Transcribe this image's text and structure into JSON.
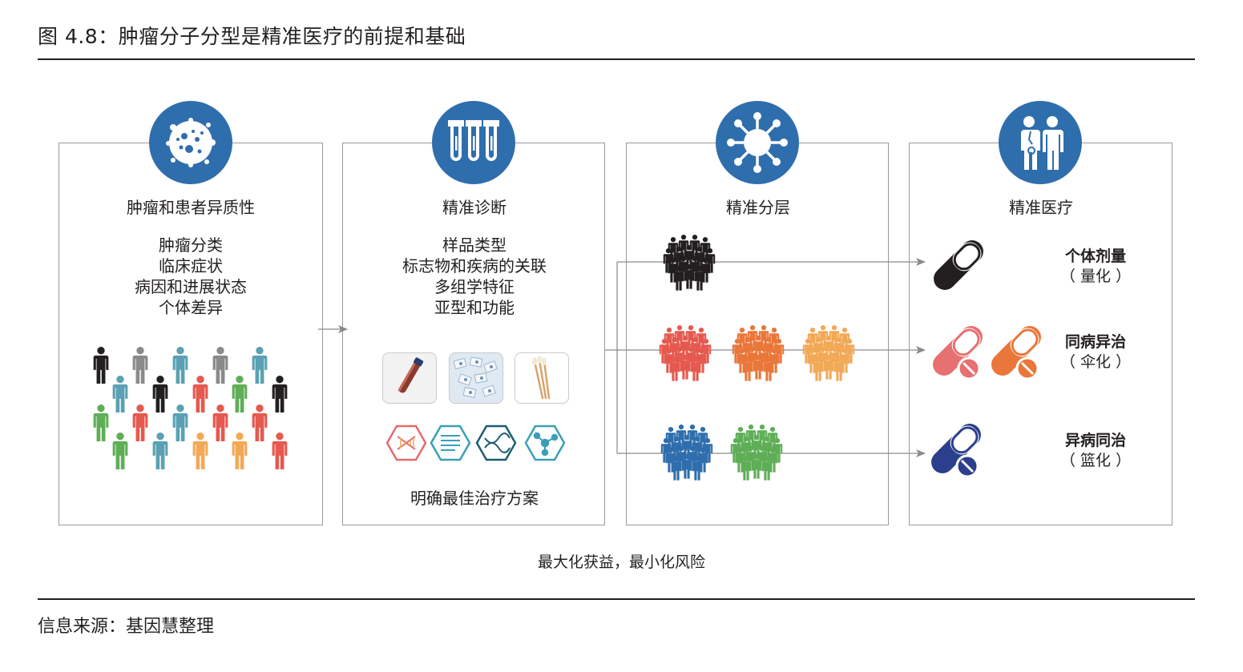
{
  "figure_title": "图 4.8：肿瘤分子分型是精准医疗的前提和基础",
  "source": "信息来源：基因慧整理",
  "colors": {
    "accent_blue": "#2f6ead",
    "black": "#231f20",
    "gray": "#8a8a8a",
    "teal": "#5aa1b3",
    "red": "#e5594f",
    "green": "#5fae57",
    "orange": "#e9773a",
    "light_orange": "#f2a957",
    "navy": "#2c3f8c",
    "pink": "#e77070"
  },
  "panels": [
    {
      "icon": "tumor-cell-icon",
      "title": "肿瘤和患者异质性",
      "items": [
        "肿瘤分类",
        "临床症状",
        "病因和进展状态",
        "个体差异"
      ]
    },
    {
      "icon": "test-tubes-icon",
      "title": "精准诊断",
      "items": [
        "样品类型",
        "标志物和疾病的关联",
        "多组学特征",
        "亚型和功能"
      ],
      "caption": "明确最佳治疗方案"
    },
    {
      "icon": "virus-icon",
      "title": "精准分层",
      "items": []
    },
    {
      "icon": "doctor-patient-icon",
      "title": "精准医疗",
      "items": []
    }
  ],
  "treatments": [
    {
      "name": "个体剂量",
      "sub": "（ 量化 ）"
    },
    {
      "name": "同病异治",
      "sub": "（ 伞化 ）"
    },
    {
      "name": "异病同治",
      "sub": "（ 篮化 ）"
    }
  ],
  "footer_note": "最大化获益，最小化风险"
}
